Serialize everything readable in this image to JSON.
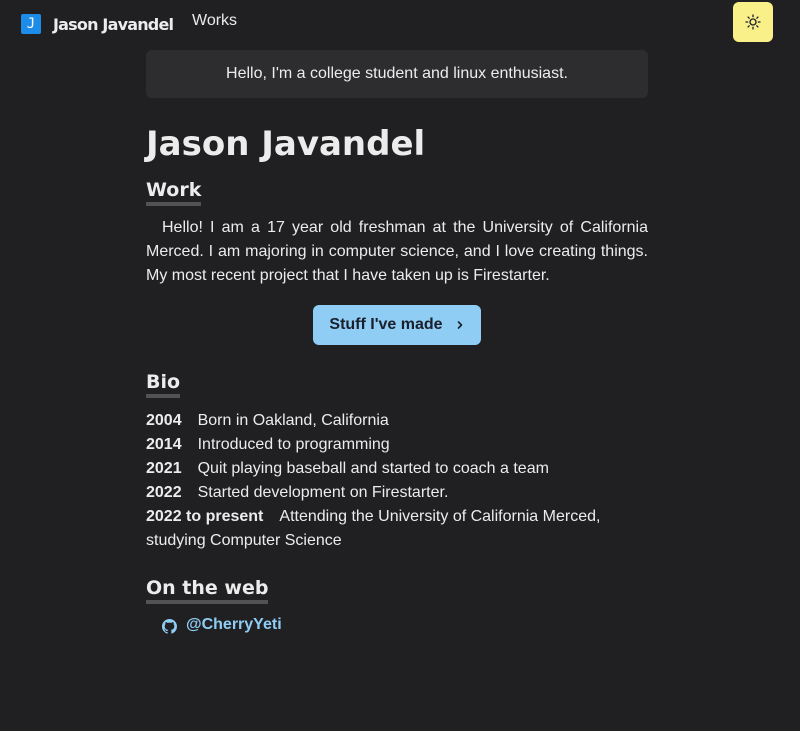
{
  "nav": {
    "logo_letter": "J",
    "logo_text": "Jason Javandel",
    "links": [
      "Works"
    ],
    "theme_toggle_icon": "sun-icon"
  },
  "greeting": "Hello, I'm a college student and linux enthusiast.",
  "name": "Jason Javandel",
  "work": {
    "heading": "Work",
    "paragraph": "Hello! I am a 17 year old freshman at the University of California Merced. I am majoring in computer science, and I love creating things. My most recent project that I have taken up is Firestarter.",
    "button_label": "Stuff I've made",
    "button_icon": "chevron-right-icon"
  },
  "bio": {
    "heading": "Bio",
    "entries": [
      {
        "year": "2004",
        "text": "Born in Oakland, California"
      },
      {
        "year": "2014",
        "text": "Introduced to programming"
      },
      {
        "year": "2021",
        "text": "Quit playing baseball and started to coach a team"
      },
      {
        "year": "2022",
        "text": "Started development on Firestarter."
      },
      {
        "year": "2022 to present",
        "text": "Attending the University of California Merced, studying Computer Science"
      }
    ]
  },
  "web": {
    "heading": "On the web",
    "links": [
      {
        "icon": "github-icon",
        "label": "@CherryYeti"
      }
    ]
  },
  "colors": {
    "background": "#202023",
    "accent_link": "#90cdf4",
    "button_bg": "#90cdf4",
    "toggle_bg": "#faf089",
    "logo_bg": "#1d8ce8"
  }
}
